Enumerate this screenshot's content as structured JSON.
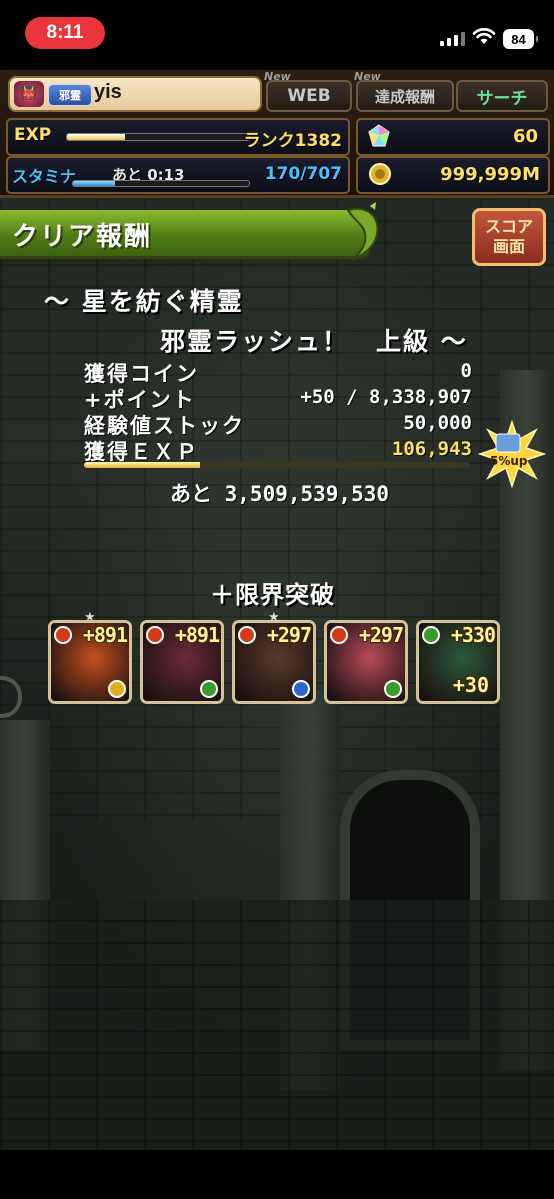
{
  "status_bar": {
    "time": "8:11",
    "battery": "84"
  },
  "hud": {
    "rank_icon": "demon-face-icon",
    "title_badge": "邪霊",
    "player_name": "yis",
    "tabs": [
      {
        "new_tag": "New",
        "label": "WEB"
      },
      {
        "new_tag": "New",
        "label": "達成報酬"
      },
      {
        "new_tag": "",
        "label": "サーチ"
      }
    ],
    "exp_label": "EXP",
    "rank_text": "ランク1382",
    "exp_progress": 0.32,
    "stamina_label": "スタミナ",
    "stamina_timer": "あと 0:13",
    "stamina_value": "170/707",
    "stamina_progress": 0.24,
    "magic_stones": "60",
    "coins": "999,999M"
  },
  "banner": {
    "title": "クリア報酬",
    "score_button": "スコア\n画面"
  },
  "dungeon": {
    "title_line1": "～ 星を紡ぐ精霊",
    "title_line2": "邪霊ラッシュ！　上級 ～"
  },
  "results": [
    {
      "label": "獲得コイン",
      "value": "0"
    },
    {
      "label": "+ポイント",
      "value": "+50 / 8,338,907"
    },
    {
      "label": "経験値ストック",
      "value": "50,000"
    },
    {
      "label": "獲得ＥＸＰ",
      "value": "106,943"
    }
  ],
  "exp_bar_progress": 0.3,
  "exp_bonus_badge": "5%up",
  "remaining": "あと 3,509,539,530",
  "limit_break_title": "＋限界突破",
  "cards": [
    {
      "plus": "+891",
      "main_color": "#d23a1a",
      "sub_color": "#e0b020",
      "art": "#c4501e",
      "star": true,
      "extra": ""
    },
    {
      "plus": "+891",
      "main_color": "#d23a1a",
      "sub_color": "#3a9a2a",
      "art": "#6b2a3a",
      "star": false,
      "extra": ""
    },
    {
      "plus": "+297",
      "main_color": "#d23a1a",
      "sub_color": "#2a6ad0",
      "art": "#5a3a2a",
      "star": true,
      "extra": ""
    },
    {
      "plus": "+297",
      "main_color": "#d23a1a",
      "sub_color": "#3a9a2a",
      "art": "#b84a5a",
      "star": false,
      "extra": ""
    },
    {
      "plus": "+330",
      "main_color": "#3a9a2a",
      "sub_color": "",
      "art": "#2a5a3a",
      "star": false,
      "extra": "+30"
    }
  ]
}
